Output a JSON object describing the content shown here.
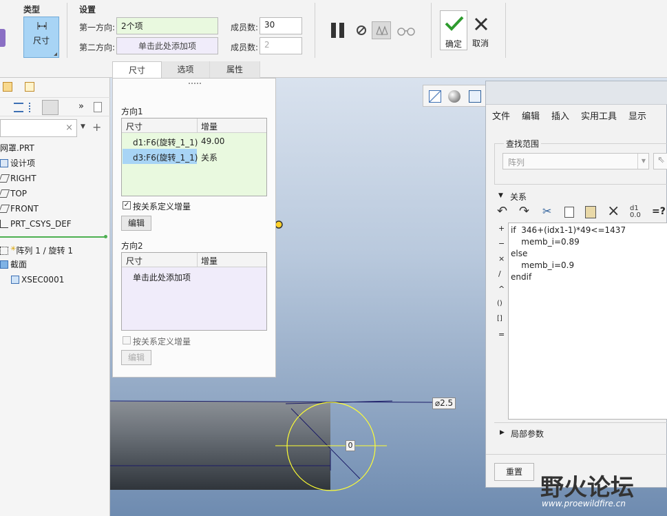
{
  "ribbon": {
    "type_label": "类型",
    "settings_label": "设置",
    "type_button_label": "尺寸",
    "first_direction_label": "第一方向:",
    "first_direction_value": "2个项",
    "second_direction_label": "第二方向:",
    "second_direction_placeholder": "单击此处添加项",
    "member_count_label_1": "成员数:",
    "member_count_value_1": "30",
    "member_count_label_2": "成员数:",
    "member_count_value_2": "2",
    "ok_label": "确定",
    "cancel_label": "取消",
    "tabs": [
      {
        "label": "尺寸"
      },
      {
        "label": "选项"
      },
      {
        "label": "属性"
      }
    ]
  },
  "tree": {
    "items": [
      {
        "label": "网罩.PRT"
      },
      {
        "label": "设计项"
      },
      {
        "label": "RIGHT"
      },
      {
        "label": "TOP"
      },
      {
        "label": "FRONT"
      },
      {
        "label": "PRT_CSYS_DEF"
      },
      {
        "label": "阵列 1 / 旋转 1"
      },
      {
        "label": "截面"
      },
      {
        "label": "XSEC0001"
      }
    ]
  },
  "options_panel": {
    "direction1_label": "方向1",
    "col_dim": "尺寸",
    "col_inc": "增量",
    "rows": [
      {
        "dim": "d1:F6(旋转_1_1)",
        "inc": "49.00"
      },
      {
        "dim": "d3:F6(旋转_1_1)",
        "inc": "关系"
      }
    ],
    "define_by_relation_1": "按关系定义增量",
    "edit_label_1": "编辑",
    "direction2_label": "方向2",
    "col_dim_2": "尺寸",
    "col_inc_2": "增量",
    "add_item_placeholder": "单击此处添加项",
    "define_by_relation_2": "按关系定义增量",
    "edit_label_2": "编辑"
  },
  "viewport": {
    "dim_label": "⌀2.5",
    "center_label": "0"
  },
  "relations": {
    "menu": [
      {
        "label": "文件"
      },
      {
        "label": "编辑"
      },
      {
        "label": "插入"
      },
      {
        "label": "实用工具"
      },
      {
        "label": "显示"
      }
    ],
    "lookup_label": "查找范围",
    "lookup_value": "阵列",
    "section_label": "关系",
    "operators": [
      "+",
      "−",
      "×",
      "/",
      "^",
      "()",
      "[]",
      "="
    ],
    "lines": [
      "if  346+(idx1-1)*49<=1437",
      "    memb_i=0.89",
      "else",
      "    memb_i=0.9",
      "endif"
    ],
    "local_params_label": "局部参数",
    "reset_label": "重置"
  },
  "watermark": {
    "brand": "野火论坛",
    "url": "www.proewildfire.cn"
  },
  "colors": {
    "accent_blue": "#a8d4f5",
    "ok_green": "#2e9b2e",
    "sketch_yellow": "#ffff33",
    "watermark_red": "#e2472b"
  }
}
